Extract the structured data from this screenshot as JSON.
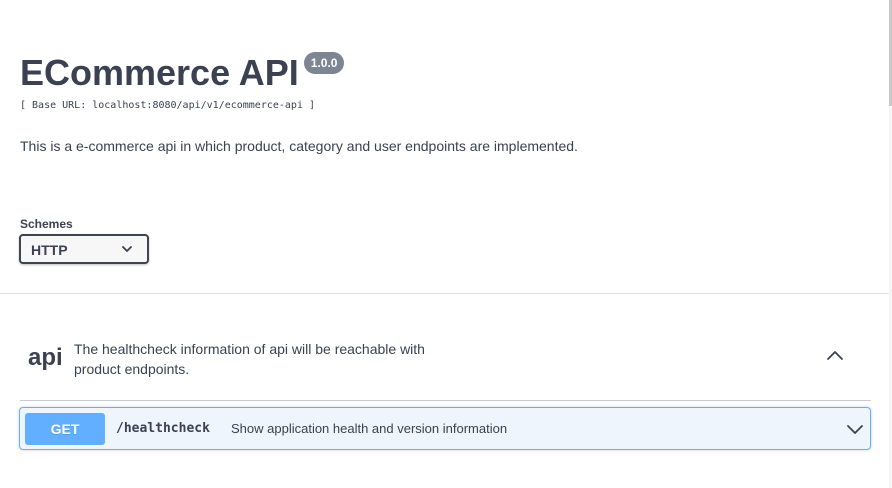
{
  "info": {
    "title": "ECommerce API",
    "version": "1.0.0",
    "base_url": "[ Base URL: localhost:8080/api/v1/ecommerce-api ]",
    "description": "This is a e-commerce api in which product, category and user endpoints are implemented."
  },
  "schemes": {
    "label": "Schemes",
    "selected": "HTTP",
    "icon": "chevron-down-icon"
  },
  "tag": {
    "name": "api",
    "description": "The healthcheck information of api will be reachable with product endpoints.",
    "toggle_icon": "chevron-up-icon"
  },
  "operation": {
    "method": "GET",
    "path": "/healthcheck",
    "summary": "Show application health and version information",
    "icon": "chevron-down-icon"
  },
  "colors": {
    "get_method": "#61affe",
    "get_background": "#eef5fd",
    "text": "#3b4151",
    "version_badge": "#7d8492"
  }
}
